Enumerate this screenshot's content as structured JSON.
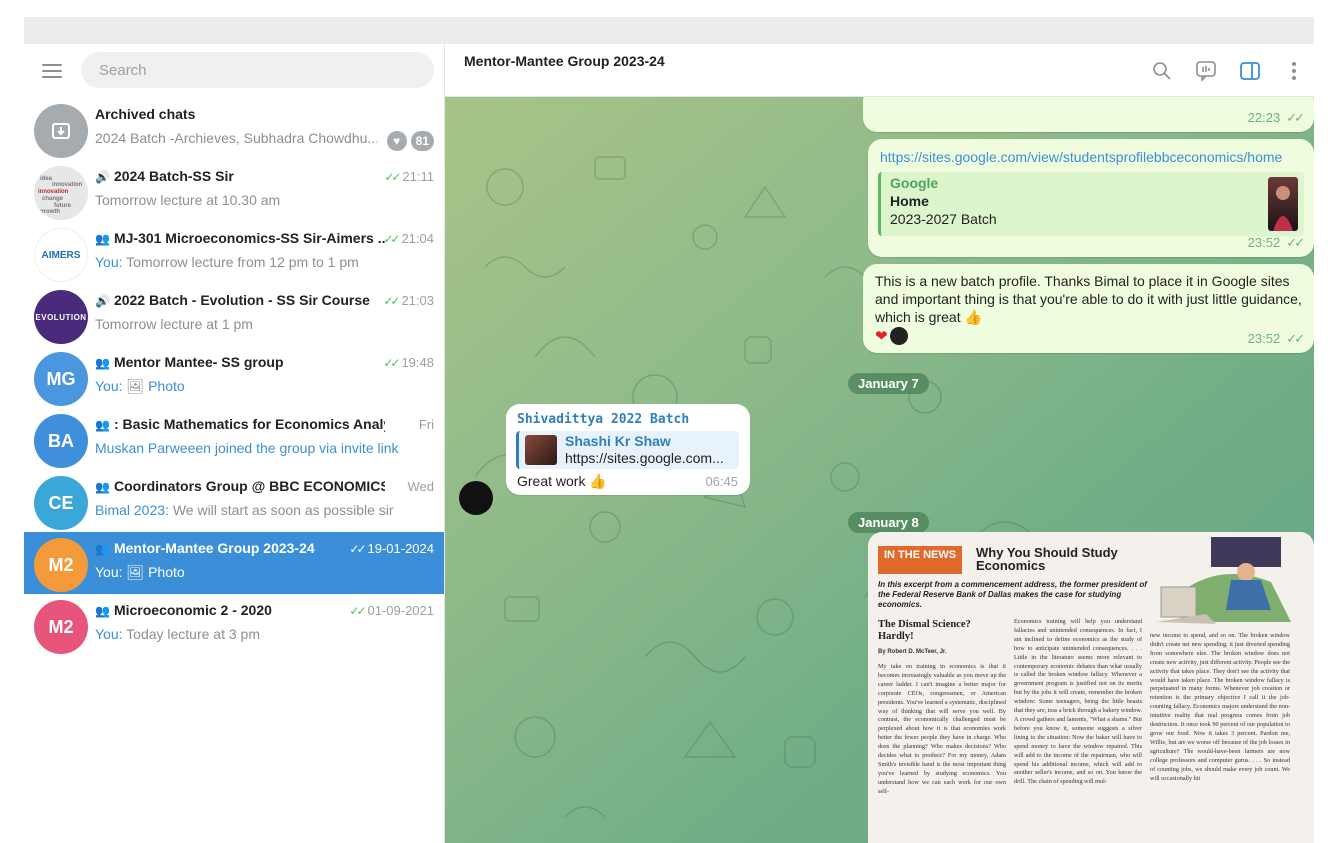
{
  "sidebar": {
    "search_placeholder": "Search",
    "chats": [
      {
        "title": "Archived chats",
        "preview": "2024 Batch -Archieves, Subhadra Chowdhu...",
        "badge": "81",
        "avatar_icon": "archive-icon",
        "avatar_color": "#a6abaf"
      },
      {
        "type": "channel",
        "title": "2024 Batch-SS Sir",
        "time": "21:11",
        "preview": "Tomorrow lecture at 10.30 am"
      },
      {
        "type": "group",
        "title": "MJ-301 Microeconomics-SS Sir-Aimers ...",
        "time": "21:04",
        "you": "You:",
        "preview": " Tomorrow lecture from 12 pm to 1 pm",
        "avatar_text": "AIMERS"
      },
      {
        "type": "channel",
        "title": "2022 Batch - Evolution - SS Sir Course",
        "time": "21:03",
        "preview": "Tomorrow lecture at 1 pm",
        "avatar_text": "EVOLUTION"
      },
      {
        "type": "group",
        "title": "Mentor Mantee- SS group",
        "time": "19:48",
        "you": "You:",
        "preview": "Photo",
        "initials": "MG",
        "avatar_color": "#4a97e0"
      },
      {
        "type": "group",
        "title": ": Basic Mathematics for Economics Analysis",
        "time": "Fri",
        "preview": "Muskan Parweeen joined the group via invite link",
        "initials": "BA",
        "avatar_color": "#3f8fdc"
      },
      {
        "type": "group",
        "title": "Coordinators Group @ BBC ECONOMICS",
        "time": "Wed",
        "you": "Bimal 2023:",
        "preview": " We will start as soon as possible sir",
        "initials": "CE",
        "avatar_color": "#3aa7d8"
      },
      {
        "type": "group",
        "title": "Mentor-Mantee Group 2023-24",
        "time": "19-01-2024",
        "you": "You:",
        "preview": "Photo",
        "initials": "M2",
        "avatar_color": "#f59a3b",
        "active": true
      },
      {
        "type": "group",
        "title": "Microeconomic 2 - 2020",
        "time": "01-09-2021",
        "you": "You:",
        "preview": " Today lecture at 3 pm",
        "initials": "M2",
        "avatar_color": "#e8557a"
      }
    ]
  },
  "main": {
    "title": "Mentor-Mantee Group 2023-24",
    "messages": {
      "m1_time": "22:23",
      "m2_link": "https://sites.google.com/view/studentsprofilebbceconomics/home",
      "m2_card_site": "Google",
      "m2_card_title": "Home",
      "m2_card_desc": "2023-2027 Batch",
      "m2_time": "23:52",
      "m3_text": "This is a new batch profile.  Thanks Bimal to place it in Google sites and important thing is that you're able to do it with just little guidance, which is great 👍",
      "m3_time": "23:52",
      "date1": "January 7",
      "m4_sender": "Shivadittya 2022 Batch",
      "m4_reply_name": "Shashi Kr Shaw",
      "m4_reply_text": "https://sites.google.com...",
      "m4_text": "Great work 👍",
      "m4_time": "06:45",
      "date2": "January 8"
    },
    "news": {
      "tag": "IN THE NEWS",
      "headline": "Why You Should Study Economics",
      "lead": "In this excerpt from a commencement address, the former president of the Federal Reserve Bank of Dallas makes the case for studying economics.",
      "sub": "The Dismal Science? Hardly!",
      "byline": "By Robert D. McTeer, Jr.",
      "col1": "My take on training in economics is that it becomes increasingly valuable as you move up the career ladder. I can't imagine a better major for corporate CEOs, congressmen, or American presidents. You've learned a systematic, disciplined way of thinking that will serve you well. By contrast, the economically challenged must be perplexed about how it is that economies work better the fewer people they have in charge. Who does the planning? Who makes decisions? Who decides what to produce? For my money, Adam Smith's invisible hand is the most important thing you've learned by studying economics. You understand how we can each work for our own self-",
      "col2": "Economics training will help you understand fallacies and unintended consequences. In fact, I am inclined to define economics as the study of how to anticipate unintended consequences. . . . Little in the literature seems more relevant to contemporary economic debates than what usually is called the broken window fallacy. Whenever a government program is justified not on its merits but by the jobs it will create, remember the broken window: Some teenagers, being the little beasts that they are, toss a brick through a bakery window. A crowd gathers and laments, \"What a shame.\" But before you know it, someone suggests a silver lining to the situation: Now the baker will have to spend money to have the window repaired. This will add to the income of the repairman, who will spend his additional income, which will add to another seller's income, and so on. You know the drill. The chain of spending will mul-",
      "col3": "new income to spend, and so on. The broken window didn't create net new spending; it just diverted spending from somewhere else. The broken window does not create new activity, just different activity. People see the activity that takes place. They don't see the activity that would have taken place. The broken window fallacy is perpetuated in many forms. Whenever job creation or retention is the primary objective I call it the job-counting fallacy. Economics majors understand the non-intuitive reality that real progress comes from job destruction. It once took 90 percent of our population to grow our food. Now it takes 3 percent. Pardon me, Willie, but are we worse off because of the job losses in agriculture? The would-have-been farmers are now college professors and computer gurus. . . . So instead of counting jobs, we should make every job count. We will occasionally hit"
    }
  },
  "colors": {
    "accent": "#3a8fd8",
    "outgoing_bubble": "#effdde",
    "ticks": "#4fbf5a",
    "date_chip": "#4a8255"
  }
}
